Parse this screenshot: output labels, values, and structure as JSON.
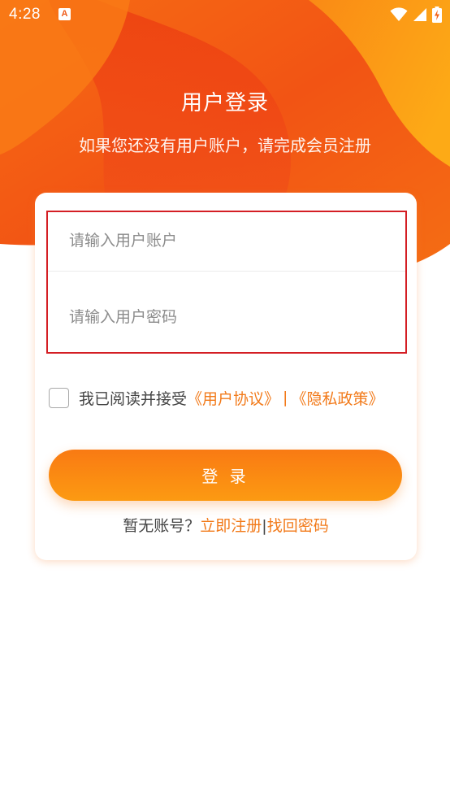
{
  "status_bar": {
    "time": "4:28",
    "notification_icon": "A",
    "icons": [
      "wifi-icon",
      "signal-icon",
      "battery-charging-icon"
    ]
  },
  "header": {
    "title": "用户登录",
    "subtitle": "如果您还没有用户账户，请完成会员注册"
  },
  "form": {
    "account_placeholder": "请输入用户账户",
    "account_value": "",
    "password_placeholder": "请输入用户密码",
    "password_value": ""
  },
  "agreement": {
    "checked": false,
    "prefix": "我已阅读并接受",
    "user_agreement": "《用户协议》",
    "separator": "|",
    "privacy_policy": "《隐私政策》"
  },
  "login_button": {
    "label": "登 录"
  },
  "footer": {
    "text": "暂无账号？",
    "register_link": "立即注册",
    "separator": "|",
    "forgot_link": "找回密码"
  },
  "colors": {
    "accent": "#f27a1a",
    "hero_primary": "#ef4a12",
    "hero_secondary": "#fb8514",
    "hero_highlight": "#fca516",
    "selection_border": "#d41e24"
  }
}
